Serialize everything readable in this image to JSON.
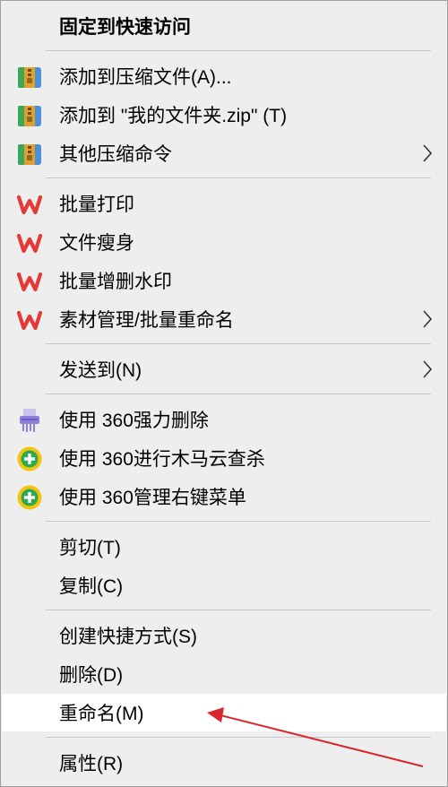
{
  "menu": {
    "pin": "固定到快速访问",
    "add_archive": "添加到压缩文件(A)...",
    "add_zip": "添加到 \"我的文件夹.zip\" (T)",
    "other_compress": "其他压缩命令",
    "batch_print": "批量打印",
    "file_slim": "文件瘦身",
    "batch_watermark": "批量增删水印",
    "material_rename": "素材管理/批量重命名",
    "send_to": "发送到(N)",
    "force_delete_360": "使用 360强力删除",
    "trojan_scan_360": "使用 360进行木马云查杀",
    "context_menu_360": "使用 360管理右键菜单",
    "cut": "剪切(T)",
    "copy": "复制(C)",
    "create_shortcut": "创建快捷方式(S)",
    "delete": "删除(D)",
    "rename": "重命名(M)",
    "properties": "属性(R)"
  },
  "icons": {
    "archive": "archive-icon",
    "wps": "wps-icon",
    "shredder": "shredder-icon",
    "security_360": "360-shield-icon",
    "submenu": "chevron-right-icon"
  },
  "colors": {
    "menu_background": "#eeeeee",
    "highlight": "#ffffff",
    "separator": "#c8c8c8",
    "wps_red": "#e53935",
    "annotation_arrow": "#d9262c"
  }
}
